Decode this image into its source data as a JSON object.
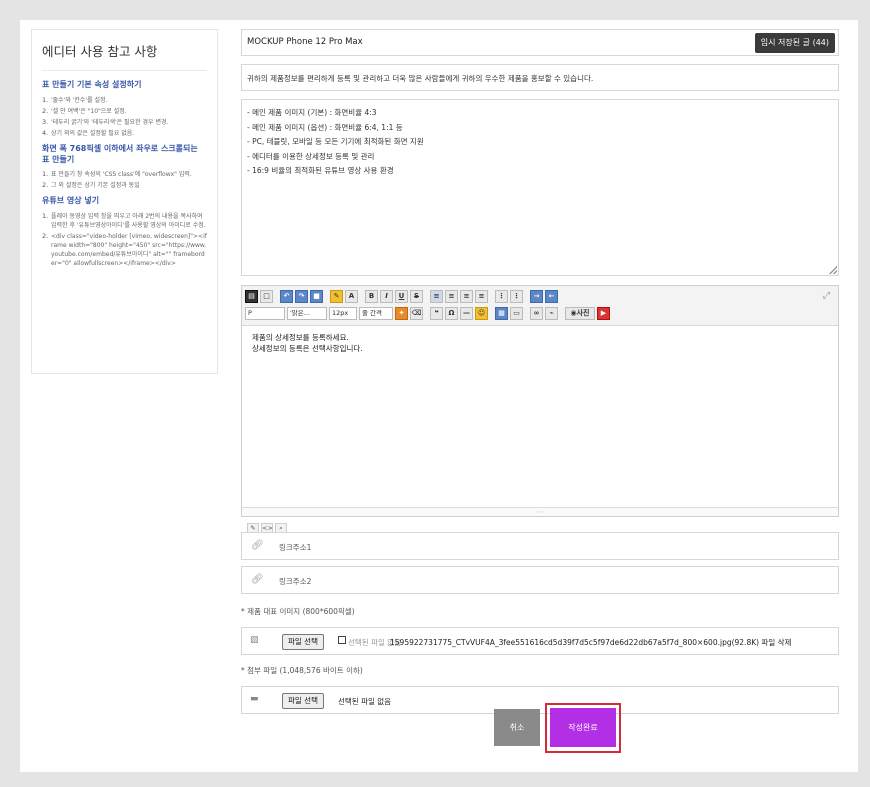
{
  "sidebar": {
    "title": "에디터 사용 참고 사항",
    "sections": [
      {
        "heading": "표 만들기 기본 속성 설정하기",
        "items": [
          {
            "n": "1.",
            "text": "'줄수'와 '칸수'를 설정."
          },
          {
            "n": "2.",
            "text": "'셀 안 여백'은 \"10\"으로 설정."
          },
          {
            "n": "3.",
            "text": "'테두리 굵기'와 '테두리색'은 필요한 경우 변경."
          },
          {
            "n": "4.",
            "text": "상기 외의 값은 설정할 필요 없음."
          }
        ]
      },
      {
        "heading": "화면 폭 768픽셀 이하에서 좌우로 스크롤되는 표 만들기",
        "items": [
          {
            "n": "1.",
            "text": "표 만들기 창 속성의 'CSS class'에 \"overflowx\" 입력."
          },
          {
            "n": "2.",
            "text": "그 외 설정은 상기 기본 설정과 동일"
          }
        ]
      },
      {
        "heading": "유튜브 영상 넣기",
        "items": [
          {
            "n": "1.",
            "text": "플레이 동영상 입력 창을 띄우고 아래 2번의 내용을 복사하여 입력한 후 '유튜브영상아이디'를 사용할 영상의 아이디로 수정."
          },
          {
            "n": "2.",
            "text": "<div class=\"video-holder [vimeo, widescreen]\"><iframe width=\"800\" height=\"450\" src=\"https://www.youtube.com/embed/유튜브아이디\" alt=\"\" frameborder=\"0\" allowfullscreen></iframe></div>"
          }
        ]
      }
    ]
  },
  "form": {
    "title_value": "MOCKUP Phone 12 Pro Max",
    "temp_saved_label": "임시 저장된 글 (44)",
    "description_value": "귀하의 제품정보를 편리하게 등록 및 관리하고 더욱 많은 사람들에게 귀하의 우수한 제품을 홍보할 수 있습니다.",
    "spec_lines": [
      "- 메인 제품 이미지 (기본) : 화면비율 4:3",
      "- 메인 제품 이미지 (옵션) : 화면비율 6:4, 1:1 등",
      "- PC, 테블릿, 모바일 등 모든 기기에 최적화된 화면 지원",
      "- 에디터를 이용한 상세정보 등록 및 관리",
      "- 16:9 비율의 최적화된 유튜브 영상 사용 환경"
    ],
    "editor": {
      "toolbar": {
        "paragraph": "P",
        "font": "'맑은...",
        "size": "12px",
        "line_height": "줄 간격",
        "photo": "사진"
      },
      "content_lines": [
        "제품의 상세정보를 등록하세요.",
        "상세정보의 등록은 선택사항입니다."
      ]
    },
    "link1_placeholder": "링크주소1",
    "link2_placeholder": "링크주소2",
    "image_label": "* 제품 대표 이미지 (800*600픽셀)",
    "image_file_button": "파일 선택",
    "image_file_text": "선택된 파일 없음",
    "image_file_current": "1595922731775_CTvVUF4A_3fee551616cd5d39f7d5c5f97de6d22db67a5f7d_800×600.jpg(92.8K) 파일 삭제",
    "attach_label": "* 첨부 파일 (1,048,576 바이트 이하)",
    "attach_file_button": "파일 선택",
    "attach_file_text": "선택된 파일 없음",
    "cancel_label": "취소",
    "submit_label": "작성완료"
  },
  "colors": {
    "accent_heading": "#3858a8",
    "submit": "#b32fe6",
    "highlight_outline": "#d42b3c"
  }
}
